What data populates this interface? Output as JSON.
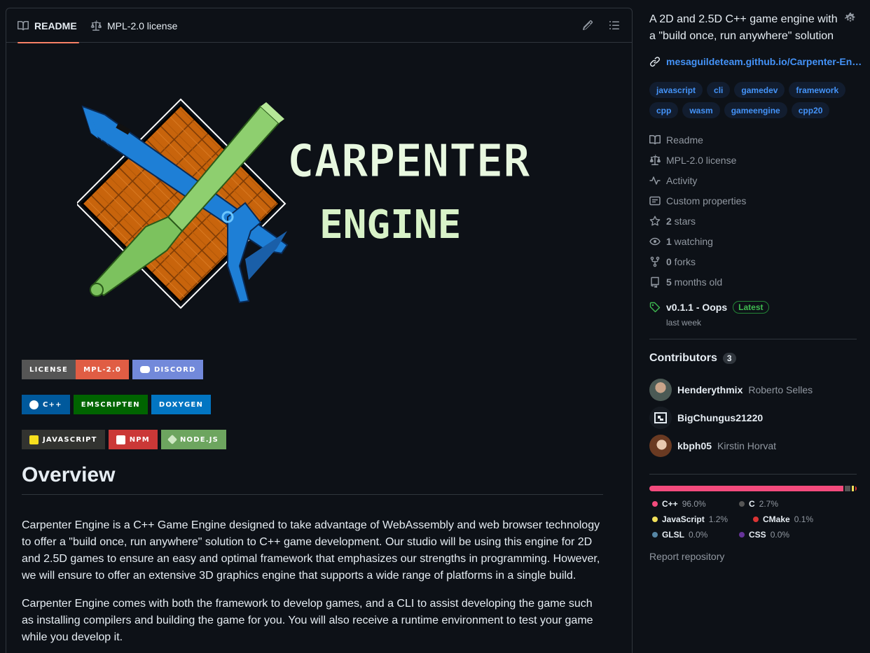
{
  "tabs": [
    {
      "label": "README",
      "icon": "book-icon",
      "active": true
    },
    {
      "label": "MPL-2.0 license",
      "icon": "law-icon",
      "active": false
    }
  ],
  "logo": {
    "line1": "CARPENTER",
    "line2": "ENGINE"
  },
  "badges": {
    "row1": [
      {
        "parts": [
          {
            "text": "LICENSE",
            "bg": "#555555"
          },
          {
            "text": "MPL-2.0",
            "bg": "#e05d44"
          }
        ]
      },
      {
        "parts": [
          {
            "text": "DISCORD",
            "bg": "#7289da",
            "icon": "discord-icon"
          }
        ]
      }
    ],
    "row2": [
      {
        "text": "C++",
        "bg": "#00599c",
        "icon": "cpp-icon"
      },
      {
        "text": "EMSCRIPTEN",
        "bg": "#006400"
      },
      {
        "text": "DOXYGEN",
        "bg": "#0275c2"
      }
    ],
    "row3": [
      {
        "text": "JAVASCRIPT",
        "bg": "#323330",
        "icon": "js-icon"
      },
      {
        "text": "NPM",
        "bg": "#cb3837",
        "icon": "npm-icon"
      },
      {
        "text": "NODE.JS",
        "bg": "#6da55f",
        "icon": "node-icon"
      }
    ]
  },
  "overview": {
    "heading": "Overview",
    "p1": "Carpenter Engine is a C++ Game Engine designed to take advantage of WebAssembly and web browser technology to offer a \"build once, run anywhere\" solution to C++ game development. Our studio will be using this engine for 2D and 2.5D games to ensure an easy and optimal framework that emphasizes our strengths in programming. However, we will ensure to offer an extensive 3D graphics engine that supports a wide range of platforms in a single build.",
    "p2": "Carpenter Engine comes with both the framework to develop games, and a CLI to assist developing the game such as installing compilers and building the game for you. You will also receive a runtime environment to test your game while you develop it."
  },
  "sidebar": {
    "about": "A 2D and 2.5D C++ game engine with a \"build once, run anywhere\" solution",
    "link": "mesaguildeteam.github.io/Carpenter-En…",
    "topics": [
      "javascript",
      "cli",
      "gamedev",
      "framework",
      "cpp",
      "wasm",
      "gameengine",
      "cpp20"
    ],
    "meta": [
      {
        "icon": "book-icon",
        "text": "Readme",
        "bold": ""
      },
      {
        "icon": "law-icon",
        "text": "MPL-2.0 license",
        "bold": ""
      },
      {
        "icon": "pulse-icon",
        "text": "Activity",
        "bold": ""
      },
      {
        "icon": "note-icon",
        "text": "Custom properties",
        "bold": ""
      },
      {
        "icon": "star-icon",
        "text": " stars",
        "bold": "2"
      },
      {
        "icon": "eye-icon",
        "text": " watching",
        "bold": "1"
      },
      {
        "icon": "fork-icon",
        "text": " forks",
        "bold": "0"
      },
      {
        "icon": "repo-icon",
        "text": " months old",
        "bold": "5"
      }
    ],
    "release": {
      "name": "v0.1.1 - Oops",
      "badge": "Latest",
      "date": "last week"
    },
    "contributors_title": "Contributors",
    "contributors_count": "3",
    "contributors": [
      {
        "login": "Henderythmix",
        "name": "Roberto Selles"
      },
      {
        "login": "BigChungus21220",
        "name": ""
      },
      {
        "login": "kbph05",
        "name": "Kirstin Horvat"
      }
    ],
    "languages": [
      {
        "name": "C++",
        "pct": "96.0%",
        "value": 96.0,
        "color": "#f34b7d"
      },
      {
        "name": "C",
        "pct": "2.7%",
        "value": 2.7,
        "color": "#555555"
      },
      {
        "name": "JavaScript",
        "pct": "1.2%",
        "value": 1.2,
        "color": "#f1e05a"
      },
      {
        "name": "CMake",
        "pct": "0.1%",
        "value": 0.1,
        "color": "#da3434"
      },
      {
        "name": "GLSL",
        "pct": "0.0%",
        "value": 0.0,
        "color": "#5686a5"
      },
      {
        "name": "CSS",
        "pct": "0.0%",
        "value": 0.0,
        "color": "#663399"
      }
    ],
    "report": "Report repository"
  }
}
